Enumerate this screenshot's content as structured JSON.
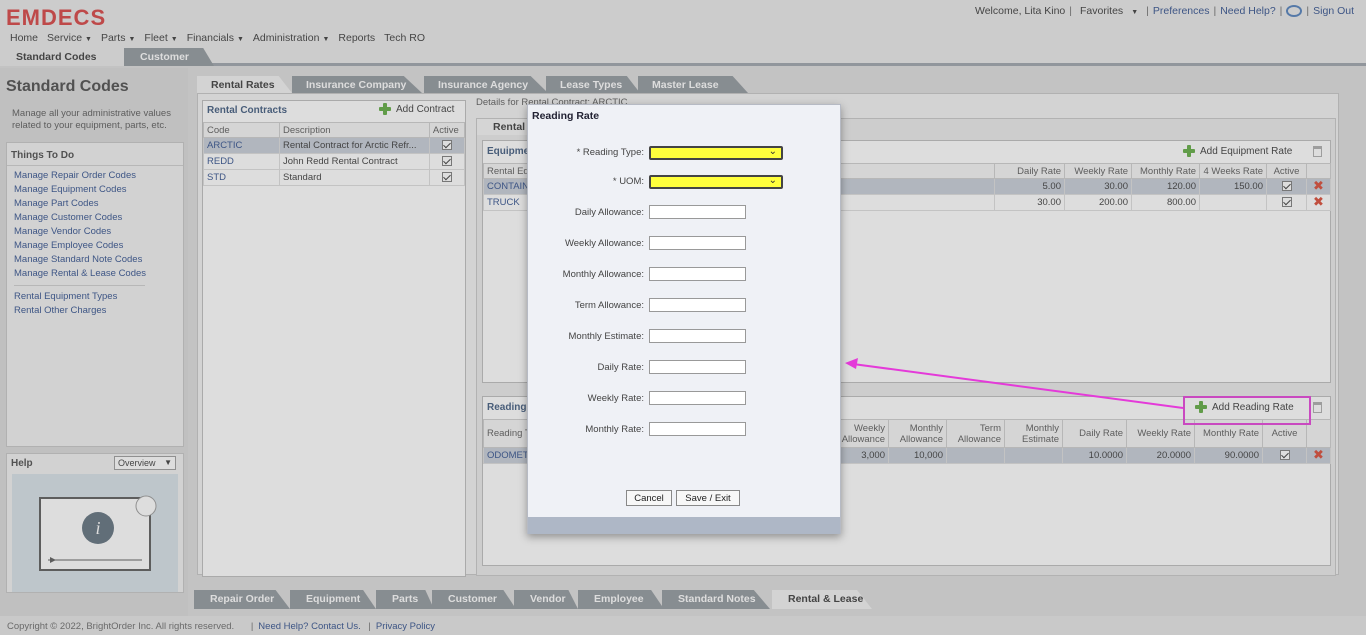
{
  "header": {
    "logo": "EMDECS",
    "welcome": "Welcome, Lita Kino",
    "favorites": "Favorites",
    "preferences": "Preferences",
    "need_help": "Need Help?",
    "sign_out": "Sign Out",
    "nav": [
      "Home",
      "Service",
      "Parts",
      "Fleet",
      "Financials",
      "Administration",
      "Reports",
      "Tech RO"
    ],
    "nav_dropdown": [
      false,
      true,
      true,
      true,
      true,
      true,
      false,
      false
    ]
  },
  "top_tabs": [
    "Standard Codes",
    "Customer"
  ],
  "left": {
    "title": "Standard Codes",
    "description": "Manage all your administrative values related to your equipment, parts, etc.",
    "todo_title": "Things To Do",
    "todo_links": [
      "Manage Repair Order Codes",
      "Manage Equipment Codes",
      "Manage Part Codes",
      "Manage Customer Codes",
      "Manage Vendor Codes",
      "Manage Employee Codes",
      "Manage Standard Note Codes",
      "Manage Rental & Lease Codes"
    ],
    "extra_links": [
      "Rental Equipment Types",
      "Rental Other Charges"
    ],
    "help_title": "Help",
    "help_select": "Overview"
  },
  "sub_tabs": [
    "Rental Rates",
    "Insurance Company",
    "Insurance Agency",
    "Lease Types",
    "Master Lease"
  ],
  "contracts": {
    "title": "Rental Contracts",
    "add_label": "Add Contract",
    "columns": [
      "Code",
      "Description",
      "Active"
    ],
    "rows": [
      {
        "code": "ARCTIC",
        "description": "Rental Contract for Arctic Refr...",
        "active": true
      },
      {
        "code": "REDD",
        "description": "John Redd Rental Contract",
        "active": true
      },
      {
        "code": "STD",
        "description": "Standard",
        "active": true
      }
    ]
  },
  "details": {
    "label": "Details for Rental Contract: ARCTIC",
    "inner_tab": "Rental",
    "equipment": {
      "title": "Equipme",
      "add_label": "Add Equipment Rate",
      "columns": [
        "Rental Eq",
        "Daily Rate",
        "Weekly Rate",
        "Monthly Rate",
        "4 Weeks Rate",
        "Active"
      ],
      "rows": [
        {
          "type": "CONTAIN",
          "daily": "5.00",
          "weekly": "30.00",
          "monthly": "120.00",
          "four_weeks": "150.00",
          "active": true
        },
        {
          "type": "TRUCK",
          "daily": "30.00",
          "weekly": "200.00",
          "monthly": "800.00",
          "four_weeks": "",
          "active": true
        }
      ]
    },
    "reading": {
      "title": "Reading",
      "add_label": "Add Reading Rate",
      "columns": [
        "Reading T",
        "Weekly Allowance",
        "Monthly Allowance",
        "Term Allowance",
        "Monthly Estimate",
        "Daily Rate",
        "Weekly Rate",
        "Monthly Rate",
        "Active"
      ],
      "rows": [
        {
          "type": "ODOMET",
          "weekly_allow": "3,000",
          "monthly_allow": "10,000",
          "term_allow": "",
          "monthly_est": "",
          "daily": "10.0000",
          "weekly": "20.0000",
          "monthly": "90.0000",
          "active": true
        }
      ]
    }
  },
  "bottom_tabs": [
    "Repair Order",
    "Equipment",
    "Parts",
    "Customer",
    "Vendor",
    "Employee",
    "Standard Notes",
    "Rental & Lease"
  ],
  "footer": {
    "copyright": "Copyright © 2022, BrightOrder Inc. All rights reserved.",
    "help_link": "Need Help? Contact Us.",
    "privacy": "Privacy Policy"
  },
  "modal": {
    "title": "Reading Rate",
    "fields": [
      {
        "label": "* Reading Type:",
        "kind": "select",
        "value": ""
      },
      {
        "label": "* UOM:",
        "kind": "select",
        "value": ""
      },
      {
        "label": "Daily Allowance:",
        "kind": "input",
        "value": ""
      },
      {
        "label": "Weekly Allowance:",
        "kind": "input",
        "value": ""
      },
      {
        "label": "Monthly Allowance:",
        "kind": "input",
        "value": ""
      },
      {
        "label": "Term Allowance:",
        "kind": "input",
        "value": ""
      },
      {
        "label": "Monthly Estimate:",
        "kind": "input",
        "value": ""
      },
      {
        "label": "Daily Rate:",
        "kind": "input",
        "value": ""
      },
      {
        "label": "Weekly Rate:",
        "kind": "input",
        "value": ""
      },
      {
        "label": "Monthly Rate:",
        "kind": "input",
        "value": ""
      }
    ],
    "cancel": "Cancel",
    "save": "Save / Exit"
  },
  "colors": {
    "brand": "#d63a3a",
    "required_field": "#ffff3c",
    "highlight": "#e43ad9",
    "link": "#2a4a8a"
  }
}
